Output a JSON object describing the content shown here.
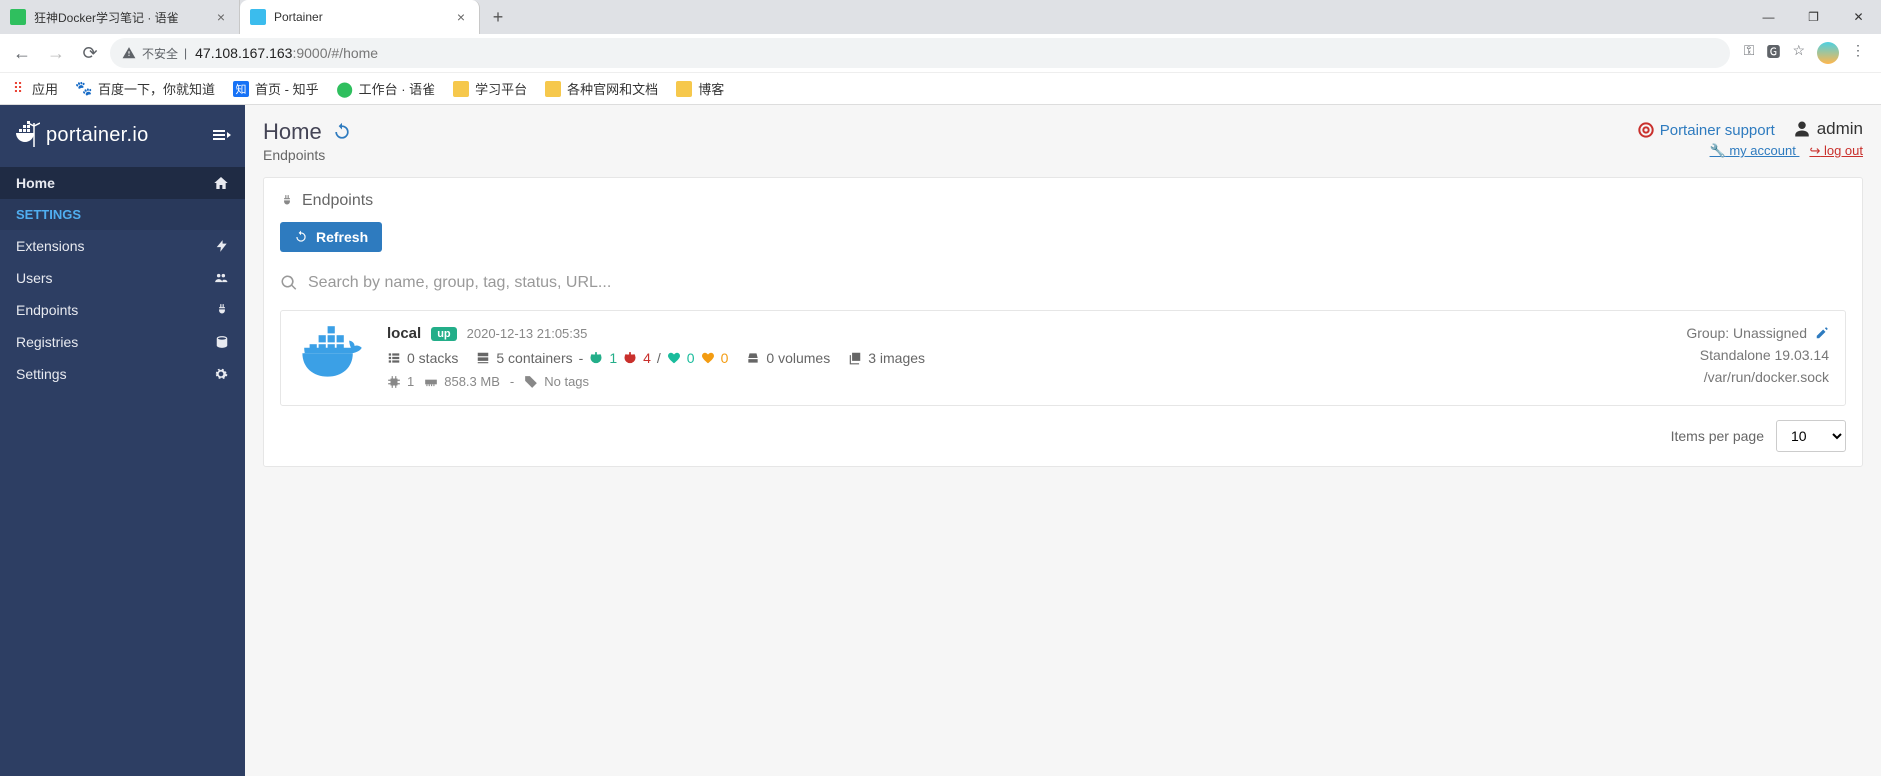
{
  "browser": {
    "tabs": [
      {
        "title": "狂神Docker学习笔记 · 语雀",
        "active": false
      },
      {
        "title": "Portainer",
        "active": true
      }
    ],
    "url_insecure_label": "不安全",
    "url_host": "47.108.167.163",
    "url_port_path": ":9000/#/home",
    "bookmarks_label": "应用",
    "bookmarks": [
      {
        "label": "百度一下，你就知道",
        "color": "#3b8cff"
      },
      {
        "label": "首页 - 知乎",
        "color": "#1772f6"
      },
      {
        "label": "工作台 · 语雀",
        "color": "#2fbf5e"
      },
      {
        "label": "学习平台",
        "color": "#f6c84c"
      },
      {
        "label": "各种官网和文档",
        "color": "#f6c84c"
      },
      {
        "label": "博客",
        "color": "#f6c84c"
      }
    ]
  },
  "sidebar": {
    "logo": "portainer.io",
    "items": [
      {
        "label": "Home",
        "active": true,
        "icon": "home"
      }
    ],
    "settings_header": "SETTINGS",
    "settings_items": [
      {
        "label": "Extensions",
        "icon": "bolt"
      },
      {
        "label": "Users",
        "icon": "users"
      },
      {
        "label": "Endpoints",
        "icon": "plug"
      },
      {
        "label": "Registries",
        "icon": "database"
      },
      {
        "label": "Settings",
        "icon": "cogs"
      }
    ]
  },
  "header": {
    "title": "Home",
    "subtitle": "Endpoints",
    "support_label": "Portainer support",
    "user_label": "admin",
    "my_account_label": " my account ",
    "logout_label": " log out"
  },
  "panel": {
    "title": "Endpoints",
    "refresh_label": "Refresh",
    "search_placeholder": "Search by name, group, tag, status, URL..."
  },
  "endpoint": {
    "name": "local",
    "status": "up",
    "timestamp": "2020-12-13 21:05:35",
    "stacks_label": "0 stacks",
    "containers_label": "5 containers",
    "containers_running": "1",
    "containers_stopped": "4",
    "containers_healthy": "0",
    "containers_unhealthy": "0",
    "volumes_label": "0 volumes",
    "images_label": "3 images",
    "cpu": "1",
    "memory": "858.3 MB",
    "separator": "-",
    "no_tags": "No tags",
    "group_label": "Group: Unassigned",
    "type_label": "Standalone 19.03.14",
    "socket": "/var/run/docker.sock"
  },
  "pager": {
    "label": "Items per page",
    "value": "10"
  }
}
